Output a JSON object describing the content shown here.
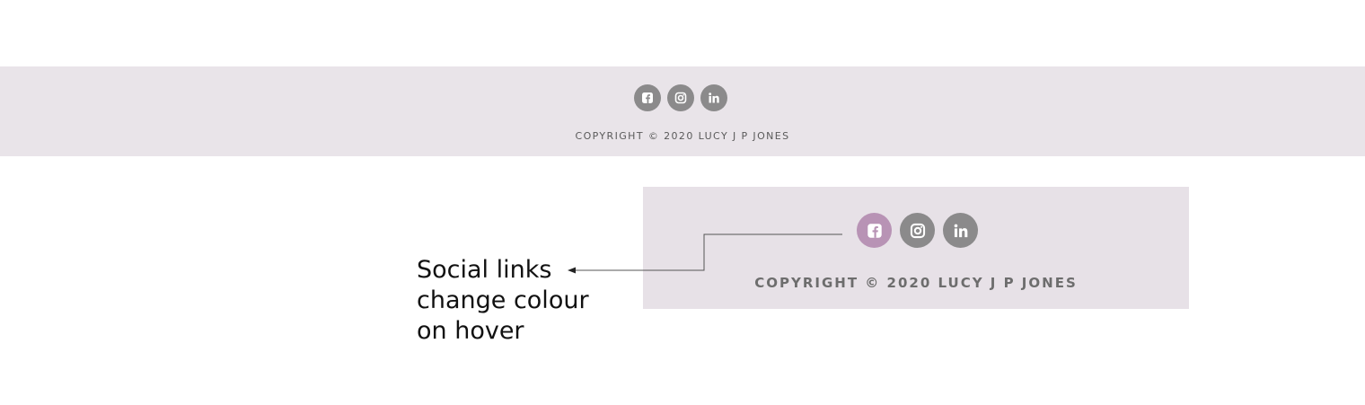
{
  "footer": {
    "social_links": [
      {
        "icon": "facebook-icon",
        "label": "f"
      },
      {
        "icon": "instagram-icon",
        "label": ""
      },
      {
        "icon": "linkedin-icon",
        "label": "in"
      }
    ],
    "copyright": "COPYRIGHT © 2020 LUCY J P JONES",
    "background_color": "#e9e4e9",
    "icon_color": "#8b8a8b"
  },
  "zoom_demo": {
    "social_links": [
      {
        "icon": "facebook-icon",
        "label": "f",
        "state": "hover"
      },
      {
        "icon": "instagram-icon",
        "label": "",
        "state": "normal"
      },
      {
        "icon": "linkedin-icon",
        "label": "in",
        "state": "normal"
      }
    ],
    "copyright": "COPYRIGHT © 2020 LUCY J P JONES",
    "hover_color": "#b893b5"
  },
  "annotation": {
    "text": "Social links\nchange colour\non hover"
  }
}
